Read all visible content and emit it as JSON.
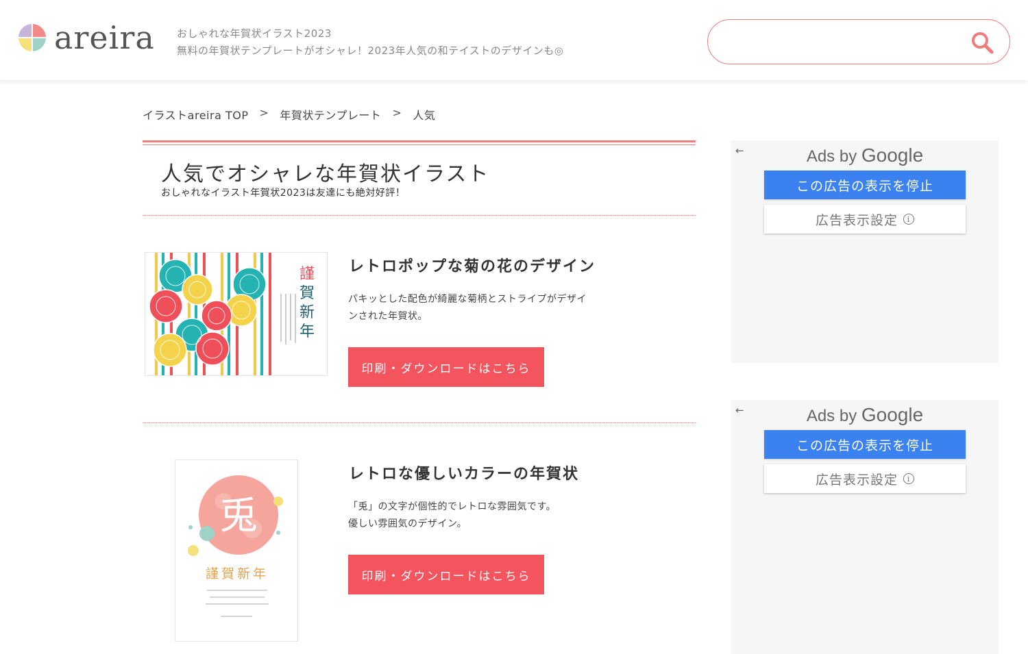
{
  "header": {
    "logo_text": "areira",
    "tagline_line1": "おしゃれな年賀状イラスト2023",
    "tagline_line2": "無料の年賀状テンプレートがオシャレ！2023年人気の和テイストのデザインも◎",
    "search": {
      "value": "",
      "placeholder": "",
      "icon": "search-icon"
    }
  },
  "breadcrumb": {
    "items": [
      "イラストareira TOP",
      "年賀状テンプレート",
      "人気"
    ],
    "separator": ">"
  },
  "section": {
    "title": "人気でオシャレな年賀状イラスト",
    "subtitle": "おしゃれなイラスト年賀状2023は友達にも絶対好評！"
  },
  "items": [
    {
      "title": "レトロポップな菊の花のデザイン",
      "desc_line1": "パキッとした配色が綺麗な菊柄とストライプがデザイ",
      "desc_line2": "ンされた年賀状。",
      "button": "印刷・ダウンロードはこちら",
      "thumb_text": [
        "謹",
        "賀",
        "新",
        "年"
      ]
    },
    {
      "title": "レトロな優しいカラーの年賀状",
      "desc_line1": "「兎」の文字が個性的でレトロな雰囲気です。",
      "desc_line2": "優しい雰囲気のデザイン。",
      "button": "印刷・ダウンロードはこちら",
      "thumb_char": "兎",
      "thumb_greeting": "謹賀新年"
    }
  ],
  "ads": [
    {
      "back": "←",
      "ads_by": "Ads by",
      "google": "Google",
      "stop": "この広告の表示を停止",
      "settings": "広告表示設定",
      "info": "i"
    },
    {
      "back": "←",
      "ads_by": "Ads by",
      "google": "Google",
      "stop": "この広告の表示を停止",
      "settings": "広告表示設定",
      "info": "i"
    }
  ],
  "colors": {
    "accent": "#f07c7c",
    "button": "#f4545e",
    "ad_blue": "#3b82f0"
  }
}
